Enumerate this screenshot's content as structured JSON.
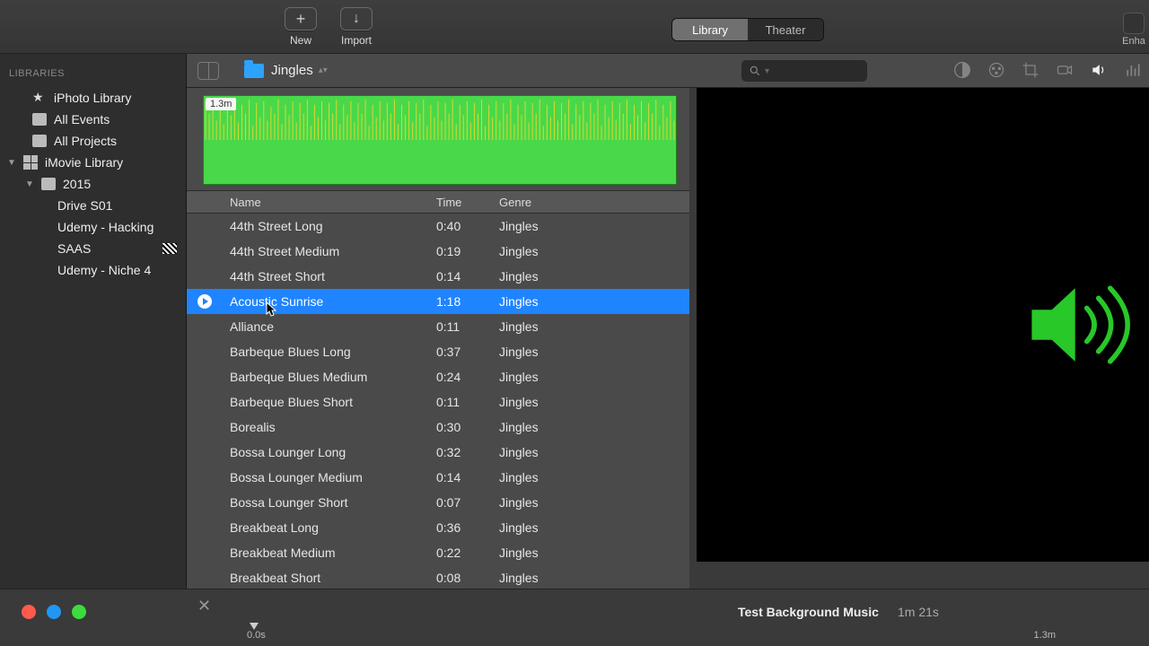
{
  "topbar": {
    "new_label": "New",
    "import_label": "Import",
    "tabs": [
      "Library",
      "Theater"
    ],
    "active_tab": 0,
    "enhance_label": "Enha"
  },
  "breadcrumb": {
    "title": "Jingles"
  },
  "search": {
    "placeholder": ""
  },
  "sidebar": {
    "header": "LIBRARIES",
    "items": [
      {
        "label": "iPhoto Library",
        "icon": "star"
      },
      {
        "label": "All Events",
        "icon": "square"
      },
      {
        "label": "All Projects",
        "icon": "square"
      },
      {
        "label": "iMovie Library",
        "icon": "grid",
        "expanded": true,
        "children": [
          {
            "label": "2015",
            "icon": "square",
            "expanded": true,
            "children": [
              {
                "label": "Drive S01"
              },
              {
                "label": "Udemy - Hacking"
              },
              {
                "label": "SAAS",
                "clapper": true
              },
              {
                "label": "Udemy - Niche 4"
              }
            ]
          }
        ]
      }
    ]
  },
  "waveform": {
    "duration_tag": "1.3m"
  },
  "table": {
    "columns": [
      "Name",
      "Time",
      "Genre"
    ],
    "rows": [
      {
        "name": "44th Street Long",
        "time": "0:40",
        "genre": "Jingles"
      },
      {
        "name": "44th Street Medium",
        "time": "0:19",
        "genre": "Jingles"
      },
      {
        "name": "44th Street Short",
        "time": "0:14",
        "genre": "Jingles"
      },
      {
        "name": "Acoustic Sunrise",
        "time": "1:18",
        "genre": "Jingles",
        "selected": true
      },
      {
        "name": "Alliance",
        "time": "0:11",
        "genre": "Jingles"
      },
      {
        "name": "Barbeque Blues Long",
        "time": "0:37",
        "genre": "Jingles"
      },
      {
        "name": "Barbeque Blues Medium",
        "time": "0:24",
        "genre": "Jingles"
      },
      {
        "name": "Barbeque Blues Short",
        "time": "0:11",
        "genre": "Jingles"
      },
      {
        "name": "Borealis",
        "time": "0:30",
        "genre": "Jingles"
      },
      {
        "name": "Bossa Lounger Long",
        "time": "0:32",
        "genre": "Jingles"
      },
      {
        "name": "Bossa Lounger Medium",
        "time": "0:14",
        "genre": "Jingles"
      },
      {
        "name": "Bossa Lounger Short",
        "time": "0:07",
        "genre": "Jingles"
      },
      {
        "name": "Breakbeat Long",
        "time": "0:36",
        "genre": "Jingles"
      },
      {
        "name": "Breakbeat Medium",
        "time": "0:22",
        "genre": "Jingles"
      },
      {
        "name": "Breakbeat Short",
        "time": "0:08",
        "genre": "Jingles"
      }
    ]
  },
  "timeline": {
    "title": "Test Background Music",
    "duration": "1m 21s",
    "start": "0.0s",
    "end": "1.3m"
  },
  "dot_colors": [
    "#ff5a4d",
    "#2196f3",
    "#3ddc3d"
  ],
  "preview_icon_color": "#28c828"
}
